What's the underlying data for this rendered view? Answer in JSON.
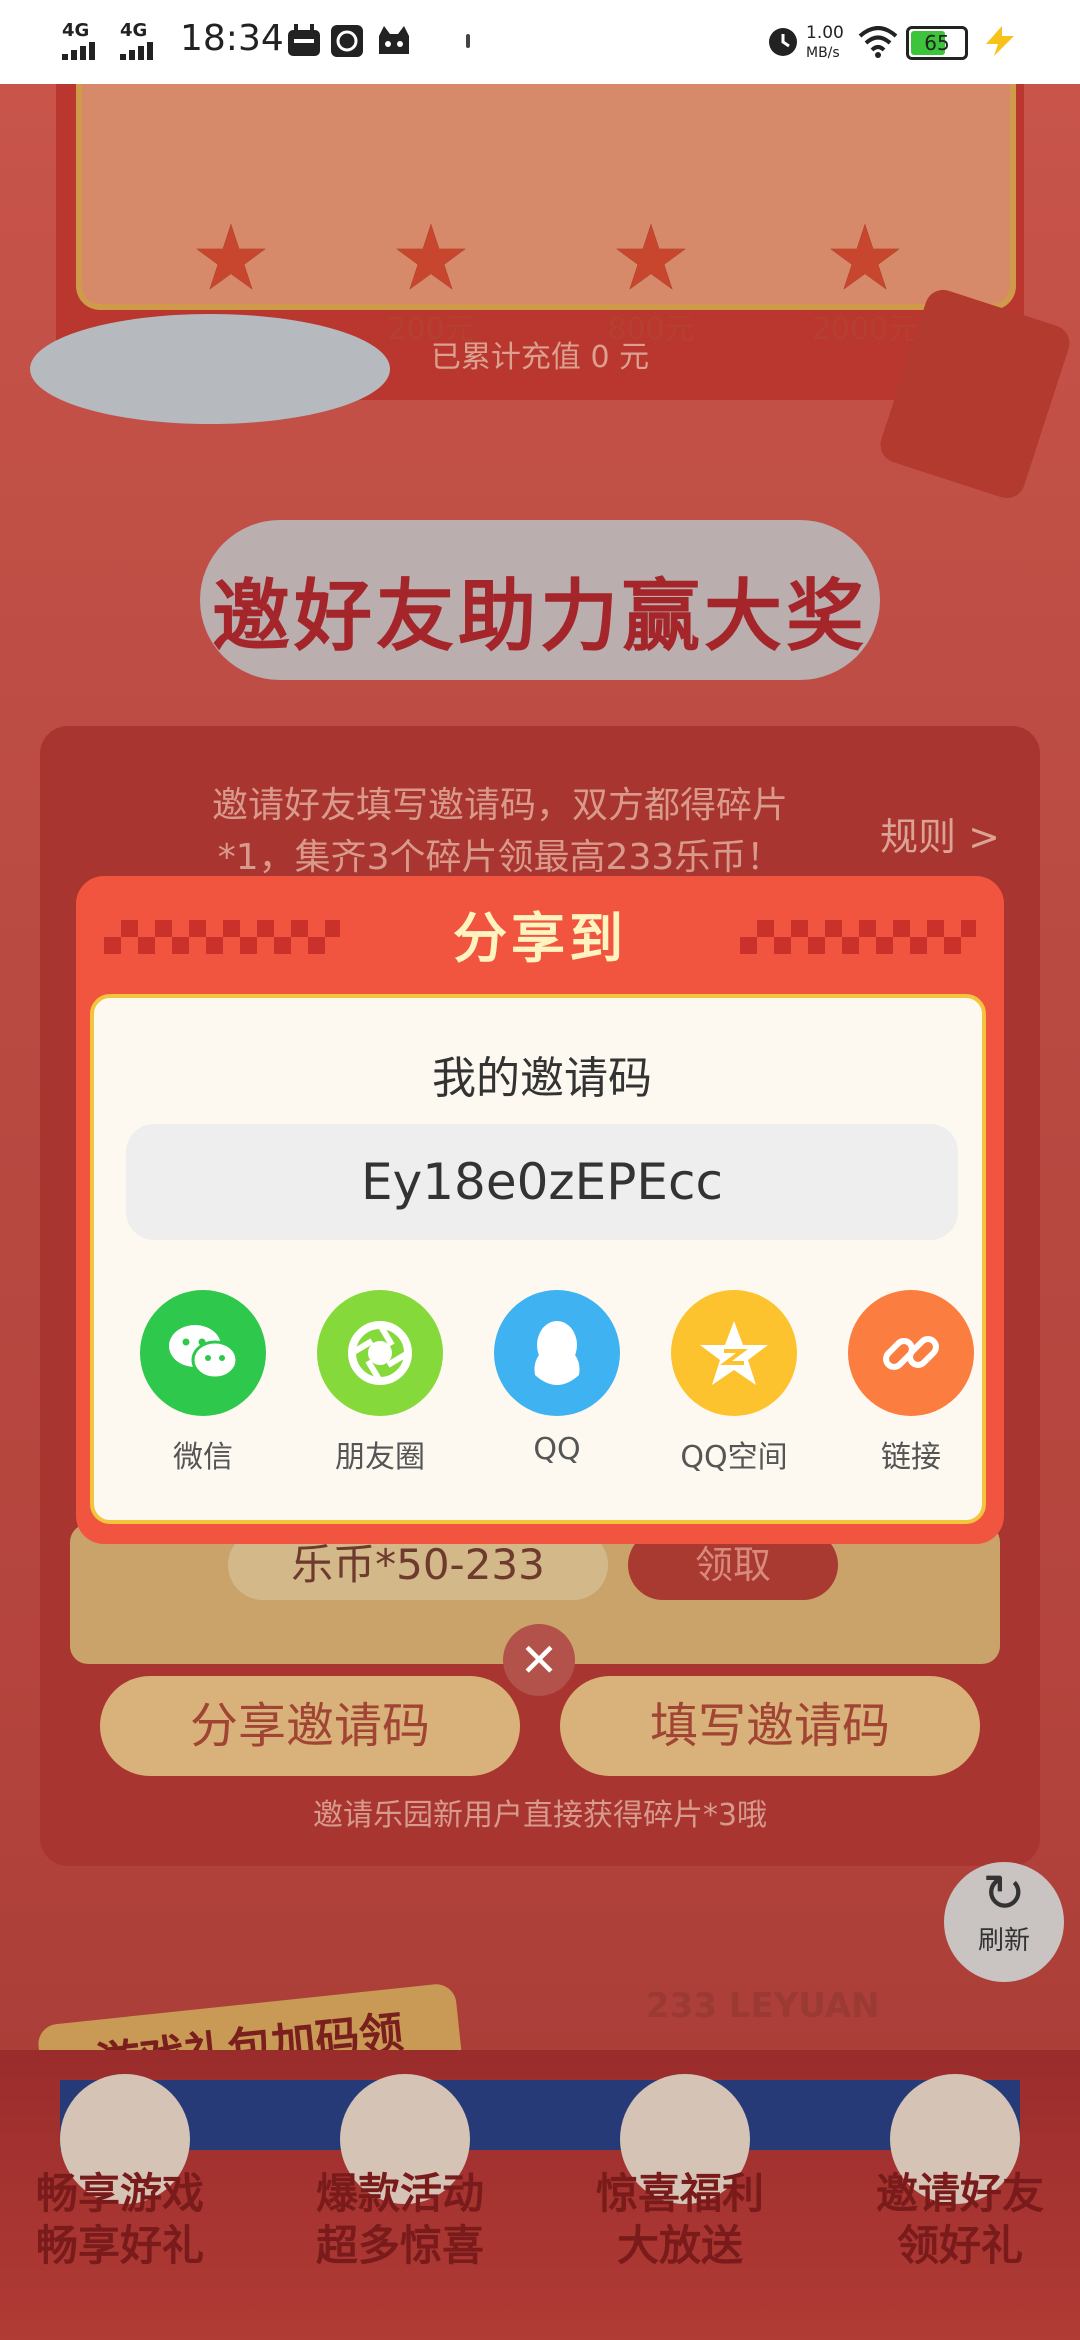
{
  "status_bar": {
    "sim1": "4G",
    "sim2": "4G",
    "time": "18:34",
    "speed": "1.00",
    "speed_unit": "MB/s",
    "battery": "65"
  },
  "milestones": [
    {
      "label": "80元"
    },
    {
      "label": "200元"
    },
    {
      "label": "800元"
    },
    {
      "label": "2000元"
    }
  ],
  "accumulated_text": "已累计充值 0 元",
  "invite_section": {
    "title": "邀好友助力赢大奖",
    "desc_line1": "邀请好友填写邀请码，双方都得碎片",
    "desc_line2": "*1，集齐3个碎片领最高233乐币！",
    "rules_link": "规则 >",
    "reward_text": "乐币*50-233",
    "claim_button": "领取",
    "share_code_button": "分享邀请码",
    "fill_code_button": "填写邀请码",
    "footer_note": "邀请乐园新用户直接获得碎片*3哦"
  },
  "refresh": {
    "label": "刷新"
  },
  "gift_banner": "游戏礼包加码领",
  "leyuan_text": "233 LEYUAN",
  "promos": [
    {
      "line1": "畅享游戏",
      "line2": "畅享好礼"
    },
    {
      "line1": "爆款活动",
      "line2": "超多惊喜"
    },
    {
      "line1": "惊喜福利",
      "line2": "大放送"
    },
    {
      "line1": "邀请好友",
      "line2": "领好礼"
    }
  ],
  "dialog": {
    "title": "分享到",
    "code_label": "我的邀请码",
    "invite_code": "Ey18e0zEPEcc",
    "share_options": [
      {
        "label": "微信",
        "icon": "wechat-icon",
        "color": "#2ec84c"
      },
      {
        "label": "朋友圈",
        "icon": "moments-icon",
        "color": "#86d93a"
      },
      {
        "label": "QQ",
        "icon": "qq-icon",
        "color": "#3fb2f2"
      },
      {
        "label": "QQ空间",
        "icon": "qzone-icon",
        "color": "#fcc32e"
      },
      {
        "label": "链接",
        "icon": "link-icon",
        "color": "#fb7d3f"
      }
    ],
    "close_symbol": "✕"
  }
}
